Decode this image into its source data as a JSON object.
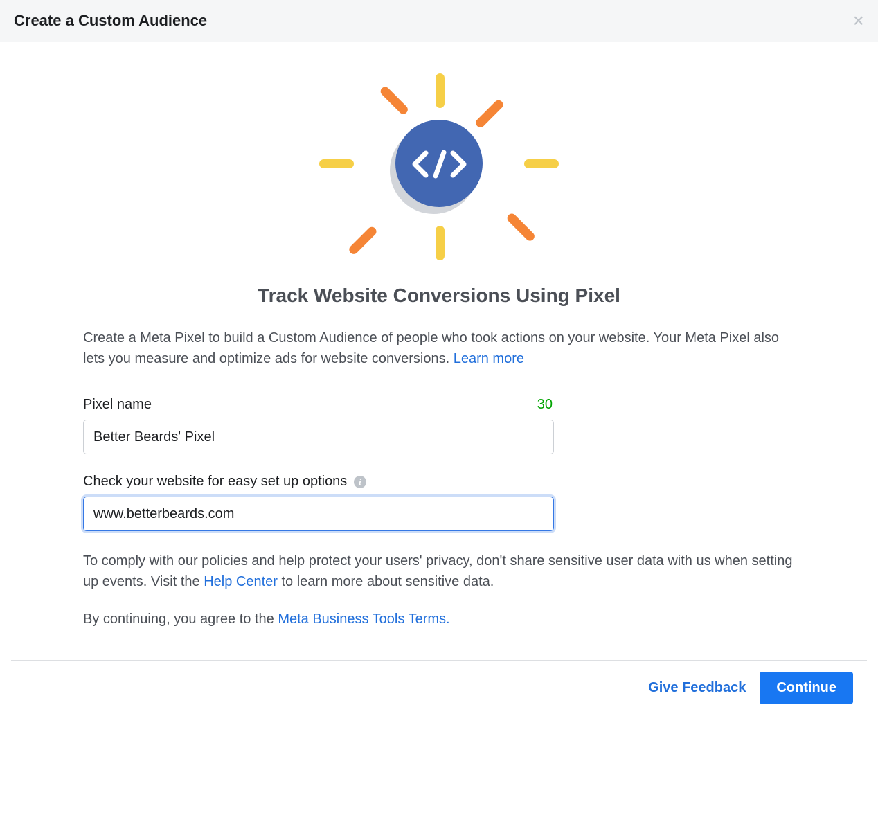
{
  "header": {
    "title": "Create a Custom Audience"
  },
  "main": {
    "headline": "Track Website Conversions Using Pixel",
    "description_text": "Create a Meta Pixel to build a Custom Audience of people who took actions on your website. Your Meta Pixel also lets you measure and optimize ads for website conversions. ",
    "learn_more_label": "Learn more",
    "pixel_name": {
      "label": "Pixel name",
      "char_count": "30",
      "value": "Better Beards' Pixel"
    },
    "website_check": {
      "label": "Check your website for easy set up options",
      "value": "www.betterbeards.com"
    },
    "policy_text_1": "To comply with our policies and help protect your users' privacy, don't share sensitive user data with us when setting up events. Visit the ",
    "help_center_label": "Help Center",
    "policy_text_2": " to learn more about sensitive data.",
    "agree_text": "By continuing, you agree to the ",
    "terms_label": "Meta Business Tools Terms."
  },
  "footer": {
    "feedback_label": "Give Feedback",
    "continue_label": "Continue"
  }
}
